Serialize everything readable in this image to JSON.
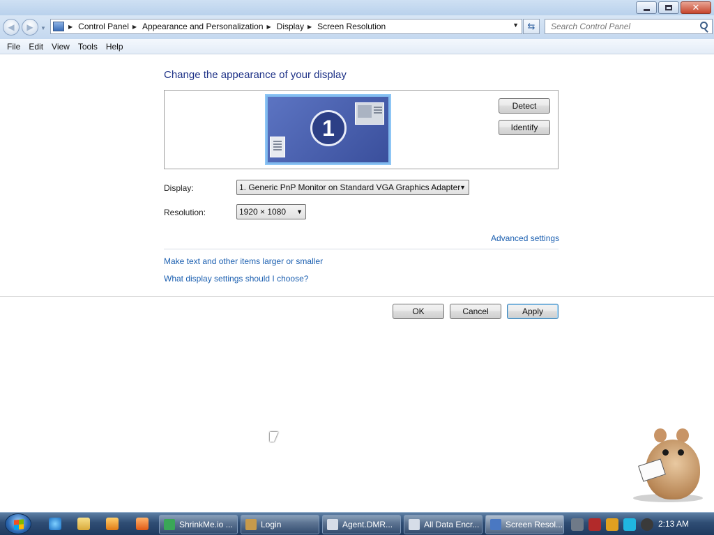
{
  "window": {
    "controls": {
      "minimize_icon": "minimize-icon",
      "maximize_icon": "restore-icon",
      "close_icon": "close-icon",
      "close_glyph": "✕"
    }
  },
  "address_bar": {
    "breadcrumbs": [
      "Control Panel",
      "Appearance and Personalization",
      "Display",
      "Screen Resolution"
    ],
    "search_placeholder": "Search Control Panel"
  },
  "menu": [
    "File",
    "Edit",
    "View",
    "Tools",
    "Help"
  ],
  "main": {
    "heading": "Change the appearance of your display",
    "monitor_number": "1",
    "detect_label": "Detect",
    "identify_label": "Identify",
    "display_label": "Display:",
    "display_value": "1. Generic PnP Monitor on Standard VGA Graphics Adapter",
    "resolution_label": "Resolution:",
    "resolution_value": "1920 × 1080",
    "advanced_link": "Advanced settings",
    "links": [
      "Make text and other items larger or smaller",
      "What display settings should I choose?"
    ],
    "ok_label": "OK",
    "cancel_label": "Cancel",
    "apply_label": "Apply"
  },
  "taskbar": {
    "tasks": [
      {
        "label": "ShrinkMe.io ...",
        "icon": "chrome-icon",
        "color": "#3aa757"
      },
      {
        "label": "Login",
        "icon": "app-icon",
        "color": "#c79a4b"
      },
      {
        "label": "Agent.DMR...",
        "icon": "window-icon",
        "color": "#d6dde8"
      },
      {
        "label": "All Data Encr...",
        "icon": "window-icon",
        "color": "#d6dde8"
      },
      {
        "label": "Screen Resol...",
        "icon": "display-icon",
        "color": "#4a78c2"
      }
    ],
    "clock": "2:13 AM"
  },
  "colors": {
    "link": "#1b5fb0",
    "heading": "#1e3287",
    "taskbar": "#2f4d74"
  }
}
